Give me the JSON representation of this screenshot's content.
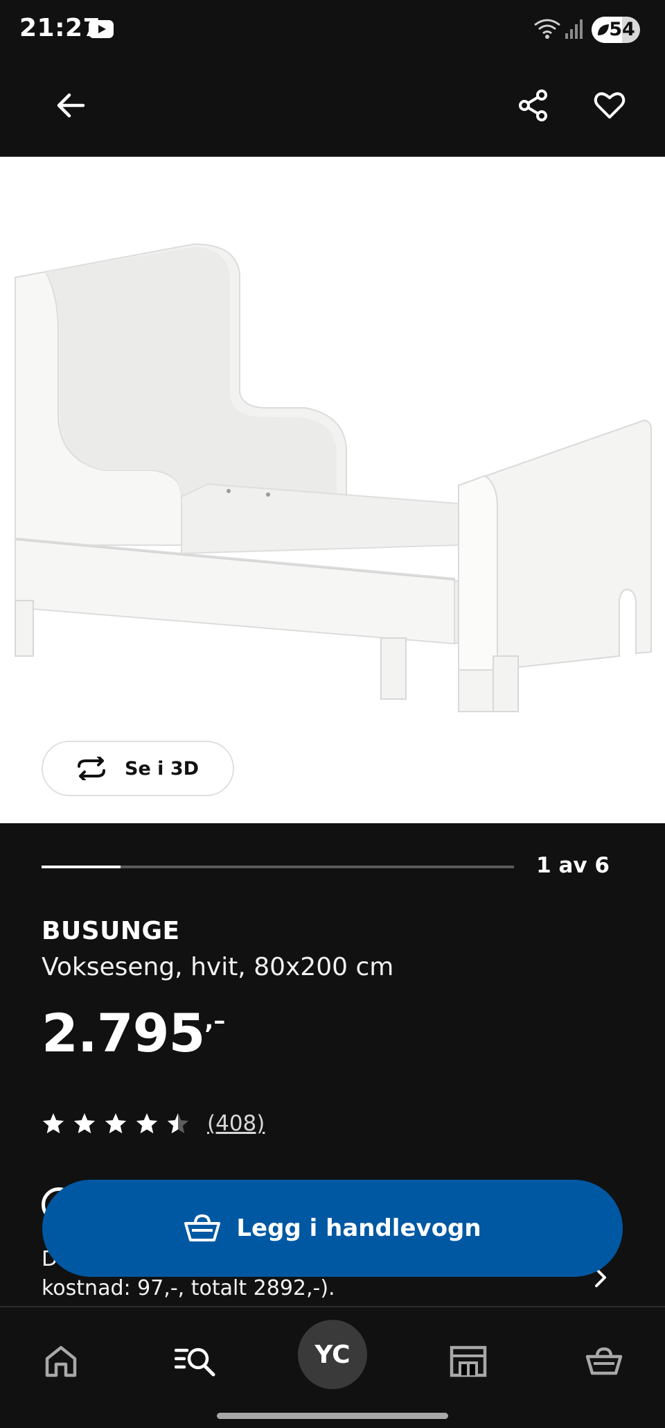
{
  "status_bar": {
    "time": "21:27",
    "battery": "54"
  },
  "gallery": {
    "view_3d_label": "Se i 3D",
    "counter": "1 av 6",
    "progress_fraction": 0.167
  },
  "product": {
    "name": "BUSUNGE",
    "description": "Vokseseng, hvit, 80x200 cm",
    "price": "2.795",
    "price_suffix": ",–",
    "rating": 4.5,
    "review_count": "(408)"
  },
  "delivery": {
    "text_line1": "D",
    "text_line2": "kostnad: 97,-, totalt 2892,-)."
  },
  "cta": {
    "add_to_cart_label": "Legg i handlevogn"
  },
  "bottom_nav": {
    "avatar_initials": "YC",
    "items": [
      "home-icon",
      "search-icon",
      "avatar",
      "store-icon",
      "cart-icon"
    ]
  },
  "colors": {
    "background": "#111111",
    "accent": "#0058a3",
    "image_background": "#ffffff"
  }
}
